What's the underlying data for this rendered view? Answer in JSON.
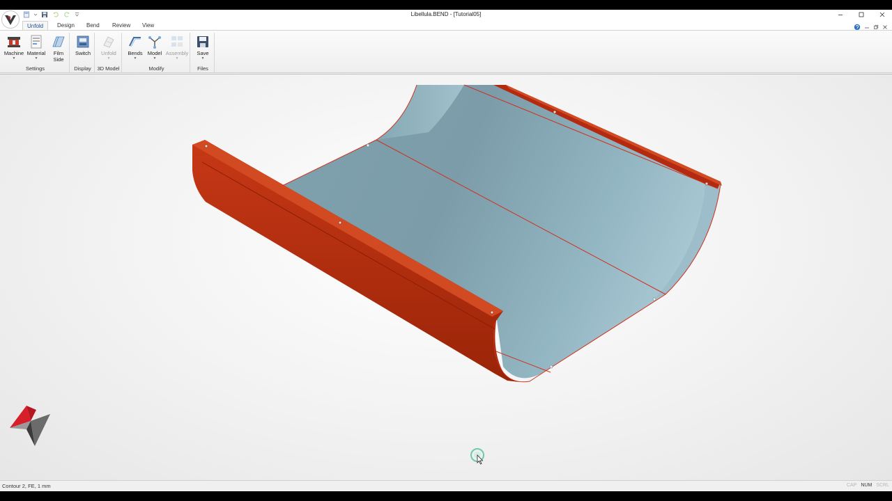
{
  "window": {
    "title": "Libellula.BEND - [Tutorial05]"
  },
  "ribbon": {
    "tabs": [
      "Unfold",
      "Design",
      "Bend",
      "Review",
      "View"
    ],
    "active_tab": "Unfold",
    "groups": {
      "settings": {
        "label": "Settings",
        "machine": "Machine",
        "material": "Material",
        "film_side": [
          "Film",
          "Side"
        ]
      },
      "display": {
        "label": "Display",
        "switch": "Switch"
      },
      "model3d": {
        "label": "3D Model",
        "unfold": "Unfold"
      },
      "modify": {
        "label": "Modify",
        "bends": "Bends",
        "model": "Model",
        "assembly": "Assembly"
      },
      "files": {
        "label": "Files",
        "save": "Save"
      }
    }
  },
  "status": {
    "text": "Contour 2, FE, 1 mm",
    "indicators": [
      {
        "name": "CAP",
        "active": false
      },
      {
        "name": "NUM",
        "active": true
      },
      {
        "name": "SCRL",
        "active": false
      }
    ]
  },
  "colors": {
    "accent_tab_text": "#1f4f8a",
    "part_flange": "#b32a10",
    "part_sheet": "#8fb2bf",
    "edge_line": "#d0301c"
  },
  "icons": {
    "app_logo": "libellula-logo-icon",
    "qat": [
      "new-icon",
      "save-icon",
      "undo-icon",
      "redo-icon",
      "customize-icon"
    ]
  }
}
